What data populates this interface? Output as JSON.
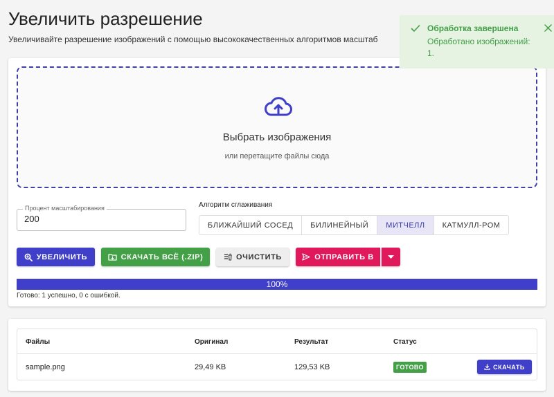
{
  "page": {
    "title": "Увеличить разрешение",
    "subtitle": "Увеличивайте разрешение изображений с помощью высококачественных алгоритмов масштаб"
  },
  "dropzone": {
    "title": "Выбрать изображения",
    "hint": "или перетащите файлы сюда",
    "icon": "cloud-upload-icon"
  },
  "scale": {
    "label": "Процент масштабирования",
    "value": "200"
  },
  "algorithm": {
    "label": "Алгоритм сглаживания",
    "options": [
      "БЛИЖАЙШИЙ СОСЕД",
      "БИЛИНЕЙНЫЙ",
      "МИТЧЕЛЛ",
      "КАТМУЛЛ-РОМ"
    ],
    "selected": "МИТЧЕЛЛ"
  },
  "actions": {
    "upscale": "УВЕЛИЧИТЬ",
    "download_zip": "СКАЧАТЬ ВСЁ (.ZIP)",
    "clear": "ОЧИСТИТЬ",
    "send_to": "ОТПРАВИТЬ В"
  },
  "progress": {
    "value": 100,
    "label": "100%",
    "status": "Готово: 1 успешно, 0 с ошибкой."
  },
  "table": {
    "headers": [
      "Файлы",
      "Оригинал",
      "Результат",
      "Статус"
    ],
    "rows": [
      {
        "file": "sample.png",
        "original": "29,49 KB",
        "result": "129,53 KB",
        "status": "ГОТОВО",
        "action": "СКАЧАТЬ"
      }
    ]
  },
  "toast": {
    "title": "Обработка завершена",
    "message": "Обработано изображений: 1."
  },
  "colors": {
    "primary": "#3f3fc9",
    "success": "#43a047",
    "accent": "#e0195d",
    "toast_bg": "#e6f2e2"
  }
}
